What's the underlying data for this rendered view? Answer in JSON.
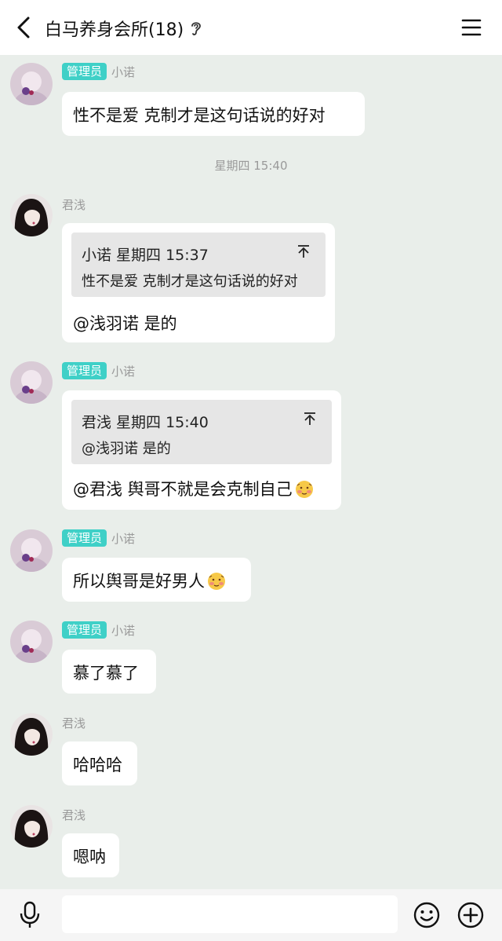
{
  "header": {
    "title": "白马养身会所(18)"
  },
  "messages": [
    {
      "admin_badge": "管理员",
      "sender": "小诺",
      "text": "性不是爱 克制才是这句话说的好对"
    },
    {
      "sender": "君浅",
      "quote_head": "小诺 星期四 15:37",
      "quote_body": "性不是爱 克制才是这句话说的好对",
      "text": "@浅羽诺 是的"
    },
    {
      "admin_badge": "管理员",
      "sender": "小诺",
      "quote_head": "君浅 星期四 15:40",
      "quote_body": "@浅羽诺 是的",
      "text": "@君浅 舆哥不就是会克制自己"
    },
    {
      "admin_badge": "管理员",
      "sender": "小诺",
      "text": "所以舆哥是好男人"
    },
    {
      "admin_badge": "管理员",
      "sender": "小诺",
      "text": "慕了慕了"
    },
    {
      "sender": "君浅",
      "text": "哈哈哈"
    },
    {
      "sender": "君浅",
      "text": "嗯呐"
    }
  ],
  "timestamp": "星期四 15:40",
  "input": {
    "value": "",
    "placeholder": ""
  },
  "icons": {
    "back": "chevron-left-icon",
    "ear": "ear-icon",
    "menu": "menu-icon",
    "mic": "microphone-icon",
    "emoji": "smiley-icon",
    "plus": "plus-circle-icon",
    "pin": "pin-top-icon"
  },
  "colors": {
    "badge": "#3fd0c7",
    "background": "#e9eeea"
  }
}
